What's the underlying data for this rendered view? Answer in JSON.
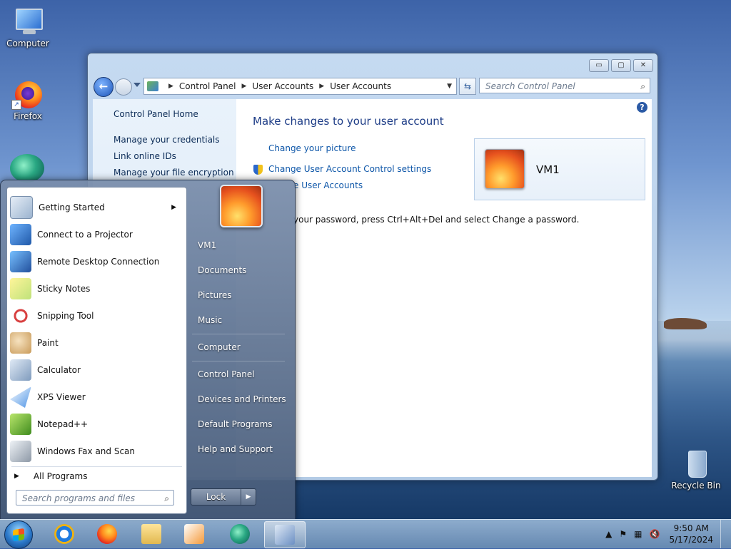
{
  "desktop": {
    "icons": [
      {
        "label": "Computer"
      },
      {
        "label": "Firefox"
      },
      {
        "label": "Recycle Bin"
      }
    ]
  },
  "control_panel": {
    "title_buttons": {
      "minimize": "▭",
      "maximize": "▢",
      "close": "✕"
    },
    "breadcrumb": [
      "Control Panel",
      "User Accounts",
      "User Accounts"
    ],
    "search_placeholder": "Search Control Panel",
    "left_nav": [
      "Control Panel Home",
      "Manage your credentials",
      "Link online IDs",
      "Manage your file encryption"
    ],
    "heading": "Make changes to your user account",
    "links": [
      "Change your picture",
      "Change User Account Control settings",
      "e User Accounts"
    ],
    "password_text": "your password, press Ctrl+Alt+Del and select Change a password.",
    "account_name": "VM1"
  },
  "start_menu": {
    "programs": [
      {
        "label": "Getting Started",
        "icon": "getting-started-icon",
        "submenu": true
      },
      {
        "label": "Connect to a Projector",
        "icon": "projector-icon"
      },
      {
        "label": "Remote Desktop Connection",
        "icon": "remote-desktop-icon"
      },
      {
        "label": "Sticky Notes",
        "icon": "sticky-notes-icon"
      },
      {
        "label": "Snipping Tool",
        "icon": "snipping-tool-icon"
      },
      {
        "label": "Paint",
        "icon": "paint-icon"
      },
      {
        "label": "Calculator",
        "icon": "calculator-icon"
      },
      {
        "label": "XPS Viewer",
        "icon": "xps-viewer-icon"
      },
      {
        "label": "Notepad++",
        "icon": "notepad-plus-plus-icon"
      },
      {
        "label": "Windows Fax and Scan",
        "icon": "fax-scan-icon"
      }
    ],
    "all_programs": "All Programs",
    "search_placeholder": "Search programs and files",
    "right_items": [
      "VM1",
      "Documents",
      "Pictures",
      "Music",
      "Computer",
      "Control Panel",
      "Devices and Printers",
      "Default Programs",
      "Help and Support"
    ],
    "lock_label": "Lock"
  },
  "taskbar": {
    "pinned": [
      "internet-explorer-icon",
      "firefox-icon",
      "windows-explorer-icon",
      "media-player-icon",
      "teal-app-icon",
      "control-panel-icon"
    ],
    "time": "9:50 AM",
    "date": "5/17/2024"
  }
}
